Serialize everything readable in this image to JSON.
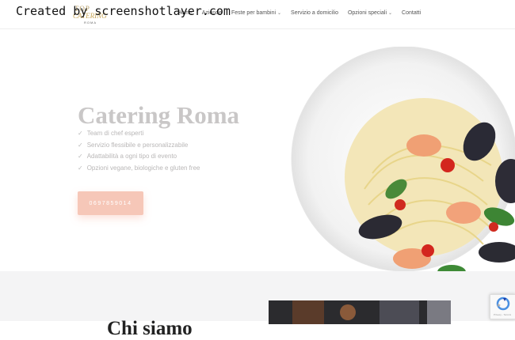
{
  "watermark": "Created by screenshotlayer.com",
  "logo": {
    "line1": "TOP",
    "line2": "CATERING",
    "line3": "ROMA"
  },
  "nav": {
    "items": [
      {
        "label": "Home",
        "has_dropdown": false
      },
      {
        "label": "Aziende",
        "has_dropdown": false
      },
      {
        "label": "Feste per bambini",
        "has_dropdown": true
      },
      {
        "label": "Servizio a domicilio",
        "has_dropdown": false
      },
      {
        "label": "Opzioni speciali",
        "has_dropdown": true
      },
      {
        "label": "Contatti",
        "has_dropdown": false
      }
    ],
    "caret": "⌄"
  },
  "hero": {
    "title": "Catering Roma",
    "features": [
      "Team di chef esperti",
      "Servizio flessibile e personalizzabile",
      "Adattabilità a ogni tipo di evento",
      "Opzioni vegane, biologiche e gluten free"
    ],
    "check_icon": "✓",
    "cta_label": "0697859014"
  },
  "about": {
    "title": "Chi siamo"
  },
  "recaptcha": {
    "privacy": "Privacy - Termini"
  },
  "colors": {
    "accent": "#f6c7b8",
    "title_grey": "#c9c7c7",
    "gold": "#c9a85a"
  }
}
